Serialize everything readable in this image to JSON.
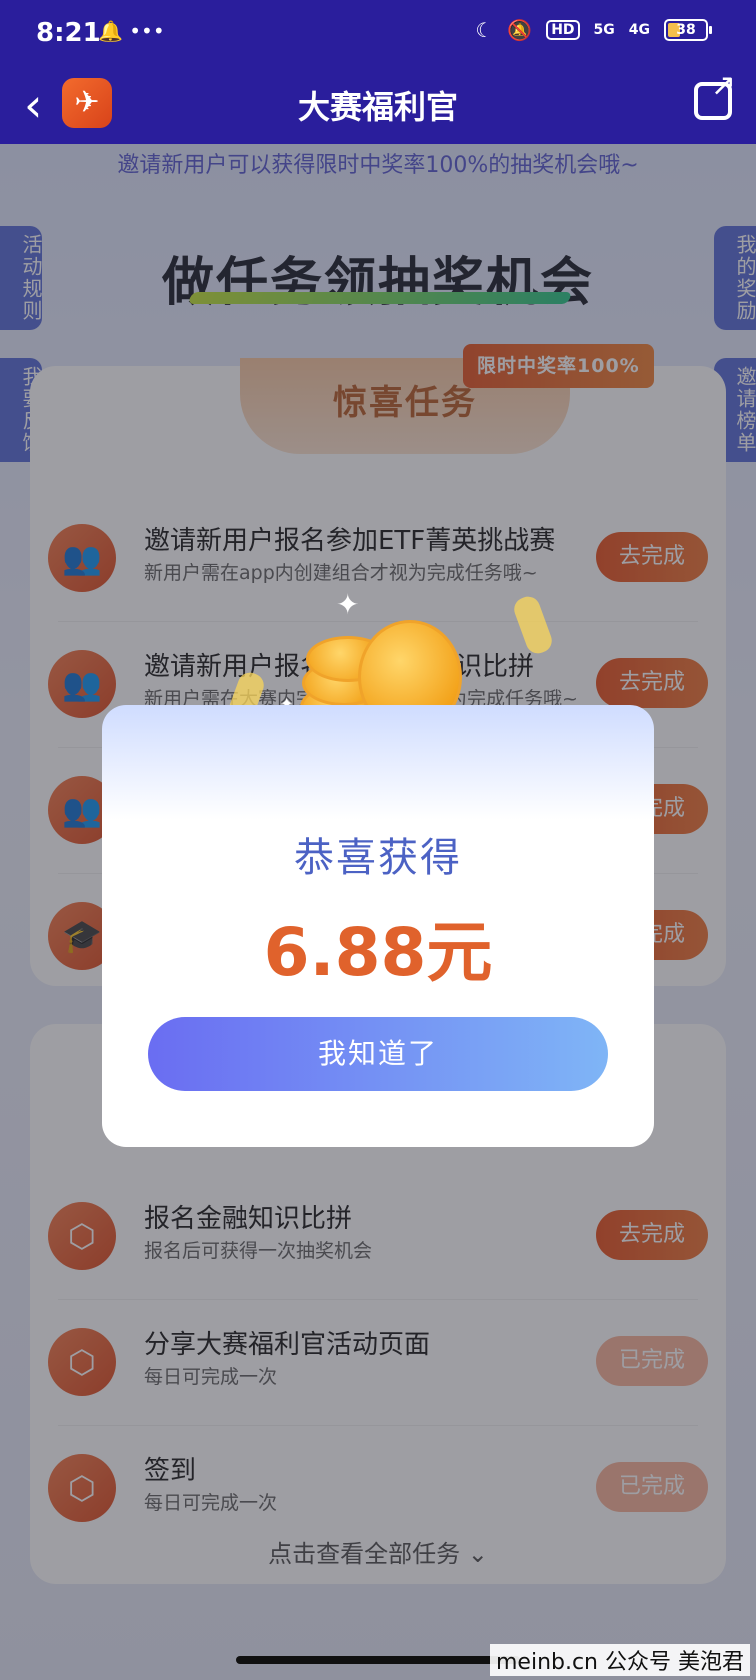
{
  "status_bar": {
    "time": "8:21",
    "notif": "🔔 •••",
    "hd": "HD",
    "sig1": "5G",
    "sig2": "4G",
    "battery": "38"
  },
  "nav": {
    "title": "大赛福利官"
  },
  "banner": "邀请新用户可以获得限时中奖率100%的抽奖机会哦~",
  "headline": "做任务领抽奖机会",
  "side_tabs": {
    "activity_rules": "活动规则",
    "feedback": "我要反馈",
    "my_rewards": "我的奖励",
    "invite_ranking": "邀请榜单"
  },
  "surprise_card": {
    "tab": "惊喜任务",
    "badge": "限时中奖率100%",
    "tasks": [
      {
        "title": "邀请新用户报名参加ETF菁英挑战赛",
        "sub": "新用户需在app内创建组合才视为完成任务哦~",
        "button": "去完成"
      },
      {
        "title": "邀请新用户报名参加金融知识比拼",
        "sub": "新用户需在大赛内完成知识比拼才视为完成任务哦~",
        "button": "去完成"
      },
      {
        "title": "",
        "sub": "",
        "button": "去完成"
      },
      {
        "title": "",
        "sub": "",
        "button": "去完成"
      }
    ]
  },
  "daily_card": {
    "tasks": [
      {
        "title": "报名金融知识比拼",
        "sub": "报名后可获得一次抽奖机会",
        "button": "去完成"
      },
      {
        "title": "分享大赛福利官活动页面",
        "sub": "每日可完成一次",
        "button": "已完成"
      },
      {
        "title": "签到",
        "sub": "每日可完成一次",
        "button": "已完成"
      }
    ],
    "view_all": "点击查看全部任务"
  },
  "modal": {
    "title": "恭喜获得",
    "amount": "6.88元",
    "ok": "我知道了"
  },
  "watermark": "meinb.cn  公众号 美泡君"
}
